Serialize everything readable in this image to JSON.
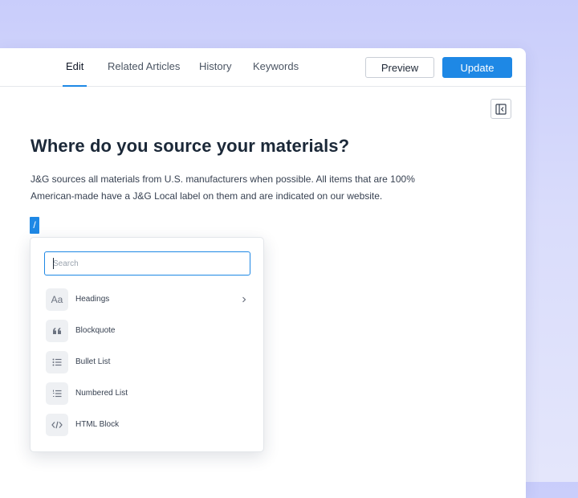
{
  "tabs": [
    {
      "label": "Edit",
      "active": true
    },
    {
      "label": "Related Articles",
      "active": false
    },
    {
      "label": "History",
      "active": false
    },
    {
      "label": "Keywords",
      "active": false
    }
  ],
  "actions": {
    "preview_label": "Preview",
    "update_label": "Update"
  },
  "article": {
    "title": "Where do you source your materials?",
    "body": "J&G sources all materials from U.S. manufacturers when possible. All items that are 100% American-made have a J&G Local label on them and are indicated on our website.",
    "slash": "/"
  },
  "block_menu": {
    "search_placeholder": "Search",
    "items": [
      {
        "label": "Headings",
        "icon": "headings-icon",
        "glyph": "Aa",
        "has_submenu": true
      },
      {
        "label": "Blockquote",
        "icon": "quote-icon",
        "glyph": "““",
        "has_submenu": false
      },
      {
        "label": "Bullet List",
        "icon": "bullet-list-icon",
        "has_submenu": false
      },
      {
        "label": "Numbered List",
        "icon": "numbered-list-icon",
        "has_submenu": false
      },
      {
        "label": "HTML Block",
        "icon": "code-icon",
        "has_submenu": false
      }
    ]
  },
  "colors": {
    "accent": "#1e88e5",
    "background": "#d5d9fb",
    "text": "#1b2838"
  }
}
